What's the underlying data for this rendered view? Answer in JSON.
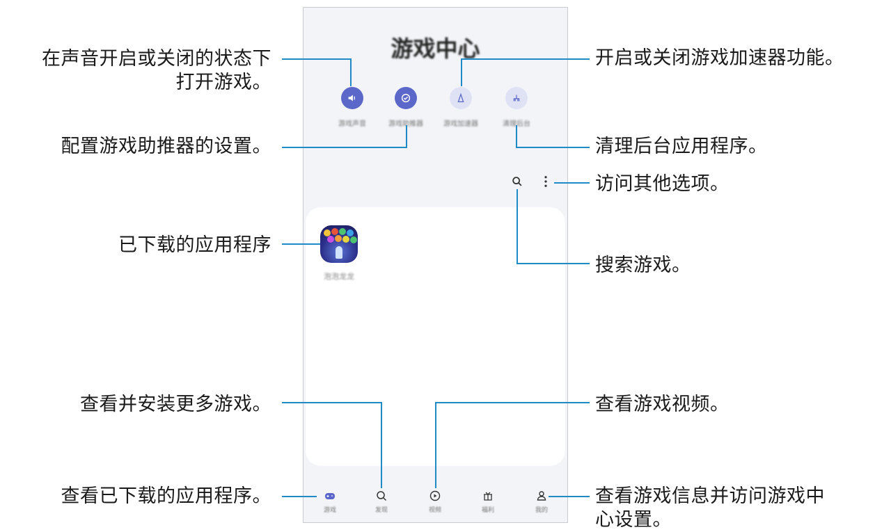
{
  "phone": {
    "title": "游戏中心",
    "quick_actions": [
      {
        "icon": "speaker-icon",
        "label": "游戏声音"
      },
      {
        "icon": "game-booster-icon",
        "label": "游戏助推器"
      },
      {
        "icon": "accelerator-icon",
        "label": "游戏加速器"
      },
      {
        "icon": "clean-background-icon",
        "label": "清理后台"
      }
    ],
    "app": {
      "icon": "bubble-game-icon",
      "label": "泡泡龙龙"
    },
    "nav": [
      {
        "icon": "gamepad-icon",
        "label": "游戏"
      },
      {
        "icon": "search-icon",
        "label": "发现"
      },
      {
        "icon": "play-icon",
        "label": "视频"
      },
      {
        "icon": "gift-icon",
        "label": "福利"
      },
      {
        "icon": "profile-icon",
        "label": "我的"
      }
    ],
    "accent_color": "#5b67c9"
  },
  "callouts": {
    "sound": "在声音开启或关闭的状态下",
    "sound_2": "打开游戏。",
    "booster": "配置游戏助推器的设置。",
    "downloaded": "已下载的应用程序",
    "install": "查看并安装更多游戏。",
    "view_downloaded": "查看已下载的应用程序。",
    "accelerator": "开启或关闭游戏加速器功能。",
    "clean": "清理后台应用程序。",
    "more_options": "访问其他选项。",
    "search": "搜索游戏。",
    "videos": "查看游戏视频。",
    "profile": "查看游戏信息并访问游戏中",
    "profile_2": "心设置。"
  },
  "line_color": "#1f8bc6"
}
